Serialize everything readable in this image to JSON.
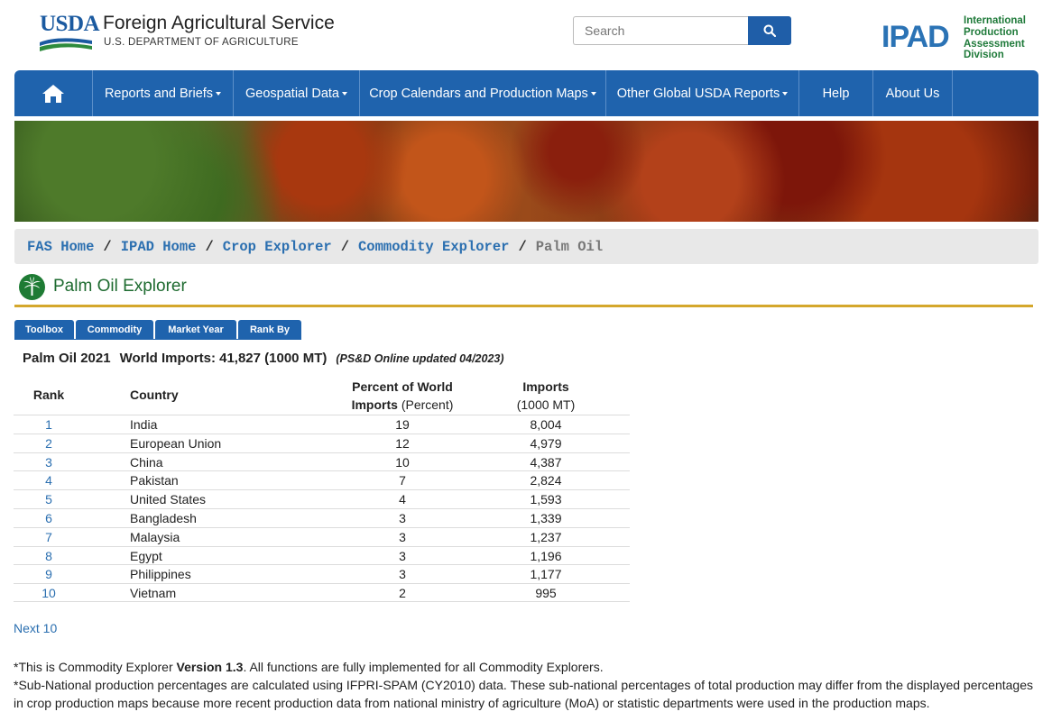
{
  "header": {
    "usda_mark": "USDA",
    "agency": "Foreign Agricultural Service",
    "department": "U.S. DEPARTMENT OF AGRICULTURE",
    "search_placeholder": "Search",
    "ipad": "IPAD",
    "ipad_lines": [
      "International",
      "Production",
      "Assessment",
      "Division"
    ]
  },
  "nav": {
    "items": [
      {
        "label": "Reports and Briefs",
        "caret": true
      },
      {
        "label": "Geospatial Data",
        "caret": true
      },
      {
        "label": "Crop Calendars and Production Maps",
        "caret": true
      },
      {
        "label": "Other Global USDA Reports",
        "caret": true
      },
      {
        "label": "Help",
        "caret": false
      },
      {
        "label": "About Us",
        "caret": false
      }
    ]
  },
  "breadcrumb": {
    "items": [
      "FAS Home",
      "IPAD Home",
      "Crop Explorer",
      "Commodity Explorer"
    ],
    "separator": "/",
    "current": "Palm Oil"
  },
  "page_title": "Palm Oil Explorer",
  "tabs": [
    "Toolbox",
    "Commodity",
    "Market Year",
    "Rank By"
  ],
  "summary": {
    "left": "Palm Oil 2021",
    "right": "World Imports: 41,827 (1000 MT)",
    "updated": "(PS&D Online updated 04/2023)"
  },
  "table": {
    "headers": {
      "rank": "Rank",
      "country": "Country",
      "pct_line1": "Percent of World",
      "pct_line2_bold": "Imports",
      "pct_line2_unit": " (Percent)",
      "imp_line1": "Imports",
      "imp_line2": "(1000 MT)"
    },
    "rows": [
      {
        "rank": "1",
        "country": "India",
        "pct": "19",
        "imports": "8,004"
      },
      {
        "rank": "2",
        "country": "European Union",
        "pct": "12",
        "imports": "4,979"
      },
      {
        "rank": "3",
        "country": "China",
        "pct": "10",
        "imports": "4,387"
      },
      {
        "rank": "4",
        "country": "Pakistan",
        "pct": "7",
        "imports": "2,824"
      },
      {
        "rank": "5",
        "country": "United States",
        "pct": "4",
        "imports": "1,593"
      },
      {
        "rank": "6",
        "country": "Bangladesh",
        "pct": "3",
        "imports": "1,339"
      },
      {
        "rank": "7",
        "country": "Malaysia",
        "pct": "3",
        "imports": "1,237"
      },
      {
        "rank": "8",
        "country": "Egypt",
        "pct": "3",
        "imports": "1,196"
      },
      {
        "rank": "9",
        "country": "Philippines",
        "pct": "3",
        "imports": "1,177"
      },
      {
        "rank": "10",
        "country": "Vietnam",
        "pct": "2",
        "imports": "995"
      }
    ]
  },
  "next_link": "Next 10",
  "footer": {
    "line1_a": "*This is Commodity Explorer ",
    "line1_bold": "Version 1.3",
    "line1_b": ". All functions are fully implemented for all Commodity Explorers.",
    "line2": "*Sub-National production percentages are calculated using IFPRI-SPAM (CY2010) data. These sub-national percentages of total production may differ from the displayed percentages in crop production maps because more recent production data from national ministry of agriculture (MoA) or statistic departments were used in the production maps."
  },
  "colors": {
    "nav_blue": "#1f63ad",
    "link_blue": "#2b6fb0",
    "title_green": "#1e6b30",
    "gold_rule": "#d4a72c"
  }
}
